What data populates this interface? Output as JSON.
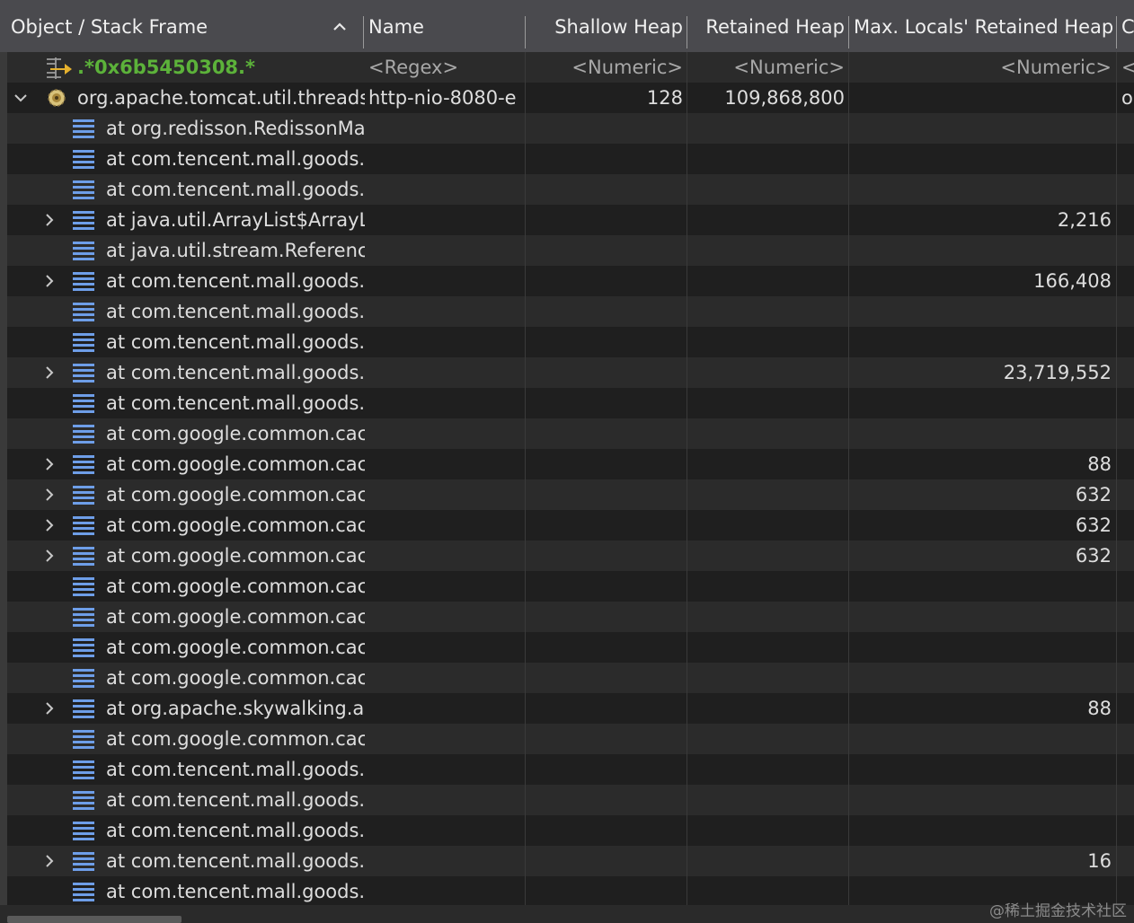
{
  "columns": {
    "object": "Object / Stack Frame",
    "name": "Name",
    "shallow": "Shallow Heap",
    "retained": "Retained Heap",
    "max_locals": "Max. Locals' Retained Heap",
    "extra": "C"
  },
  "filter_row": {
    "object": ".*0x6b5450308.*",
    "name": "<Regex>",
    "shallow": "<Numeric>",
    "retained": "<Numeric>",
    "max_locals": "<Numeric>",
    "extra": "<"
  },
  "thread_row": {
    "object": "org.apache.tomcat.util.threads",
    "name": "http-nio-8080-e",
    "shallow": "128",
    "retained": "109,868,800",
    "max_locals": "",
    "extra": "o"
  },
  "frames": [
    {
      "text": "at org.redisson.RedissonMa",
      "value": "",
      "expandable": false
    },
    {
      "text": "at com.tencent.mall.goods.",
      "value": "",
      "expandable": false
    },
    {
      "text": "at com.tencent.mall.goods.",
      "value": "",
      "expandable": false
    },
    {
      "text": "at java.util.ArrayList$ArrayL",
      "value": "2,216",
      "expandable": true
    },
    {
      "text": "at java.util.stream.Referenc",
      "value": "",
      "expandable": false
    },
    {
      "text": "at com.tencent.mall.goods.",
      "value": "166,408",
      "expandable": true
    },
    {
      "text": "at com.tencent.mall.goods.",
      "value": "",
      "expandable": false
    },
    {
      "text": "at com.tencent.mall.goods.",
      "value": "",
      "expandable": false
    },
    {
      "text": "at com.tencent.mall.goods.",
      "value": "23,719,552",
      "expandable": true
    },
    {
      "text": "at com.tencent.mall.goods.",
      "value": "",
      "expandable": false
    },
    {
      "text": "at com.google.common.cac",
      "value": "",
      "expandable": false
    },
    {
      "text": "at com.google.common.cac",
      "value": "88",
      "expandable": true
    },
    {
      "text": "at com.google.common.cac",
      "value": "632",
      "expandable": true
    },
    {
      "text": "at com.google.common.cac",
      "value": "632",
      "expandable": true
    },
    {
      "text": "at com.google.common.cac",
      "value": "632",
      "expandable": true
    },
    {
      "text": "at com.google.common.cac",
      "value": "",
      "expandable": false
    },
    {
      "text": "at com.google.common.cac",
      "value": "",
      "expandable": false
    },
    {
      "text": "at com.google.common.cac",
      "value": "",
      "expandable": false
    },
    {
      "text": "at com.google.common.cac",
      "value": "",
      "expandable": false
    },
    {
      "text": "at org.apache.skywalking.ap",
      "value": "88",
      "expandable": true
    },
    {
      "text": "at com.google.common.cac",
      "value": "",
      "expandable": false
    },
    {
      "text": "at com.tencent.mall.goods.",
      "value": "",
      "expandable": false
    },
    {
      "text": "at com.tencent.mall.goods.",
      "value": "",
      "expandable": false
    },
    {
      "text": "at com.tencent.mall.goods.",
      "value": "",
      "expandable": false
    },
    {
      "text": "at com.tencent.mall.goods.",
      "value": "16",
      "expandable": true
    },
    {
      "text": "at com.tencent.mall.goods.",
      "value": "",
      "expandable": false
    }
  ],
  "watermark": "@稀土掘金技术社区",
  "icons": {
    "sort": "sort-ascending-icon",
    "filter": "filter-arrow-icon",
    "thread": "gear-thread-icon",
    "frame": "stack-frame-icon",
    "expand": "chevron-right-icon",
    "collapse": "chevron-down-icon"
  },
  "colors": {
    "header_bg": "#4a4a4e",
    "row_alt": "#2b2b2b",
    "row_bg": "#1f1f1f",
    "filter_match": "#5cb23a",
    "frame_icon": "#6e9ee8"
  }
}
